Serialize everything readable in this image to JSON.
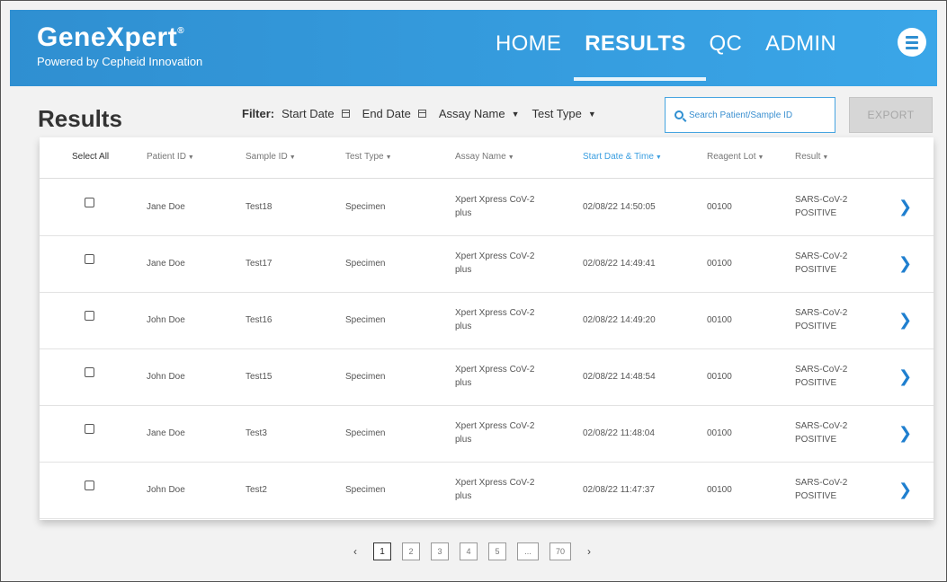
{
  "brand": {
    "name": "GeneXpert",
    "reg": "®",
    "tagline": "Powered by Cepheid Innovation"
  },
  "nav": {
    "items": [
      "HOME",
      "RESULTS",
      "QC",
      "ADMIN"
    ],
    "active": "RESULTS"
  },
  "page": {
    "title": "Results"
  },
  "filter": {
    "label": "Filter:",
    "start_date": "Start Date",
    "end_date": "End Date",
    "assay_name": "Assay Name",
    "test_type": "Test Type"
  },
  "search": {
    "placeholder": "Search Patient/Sample ID"
  },
  "export_label": "EXPORT",
  "table": {
    "headers": {
      "select_all": "Select All",
      "patient_id": "Patient ID",
      "sample_id": "Sample ID",
      "test_type": "Test Type",
      "assay_name": "Assay Name",
      "start_date_time": "Start Date & Time",
      "reagent_lot": "Reagent Lot",
      "result": "Result"
    },
    "sort_glyph": "▼",
    "rows": [
      {
        "patient": "Jane Doe",
        "sample": "Test18",
        "type": "Specimen",
        "assay1": "Xpert Xpress CoV-2",
        "assay2": "plus",
        "datetime": "02/08/22 14:50:05",
        "lot": "00100",
        "result1": "SARS-CoV-2",
        "result2": "POSITIVE"
      },
      {
        "patient": "Jane Doe",
        "sample": "Test17",
        "type": "Specimen",
        "assay1": "Xpert Xpress CoV-2",
        "assay2": "plus",
        "datetime": "02/08/22 14:49:41",
        "lot": "00100",
        "result1": "SARS-CoV-2",
        "result2": "POSITIVE"
      },
      {
        "patient": "John Doe",
        "sample": "Test16",
        "type": "Specimen",
        "assay1": "Xpert Xpress CoV-2",
        "assay2": "plus",
        "datetime": "02/08/22 14:49:20",
        "lot": "00100",
        "result1": "SARS-CoV-2",
        "result2": "POSITIVE"
      },
      {
        "patient": "John Doe",
        "sample": "Test15",
        "type": "Specimen",
        "assay1": "Xpert Xpress CoV-2",
        "assay2": "plus",
        "datetime": "02/08/22 14:48:54",
        "lot": "00100",
        "result1": "SARS-CoV-2",
        "result2": "POSITIVE"
      },
      {
        "patient": "Jane Doe",
        "sample": "Test3",
        "type": "Specimen",
        "assay1": "Xpert Xpress CoV-2",
        "assay2": "plus",
        "datetime": "02/08/22 11:48:04",
        "lot": "00100",
        "result1": "SARS-CoV-2",
        "result2": "POSITIVE"
      },
      {
        "patient": "John Doe",
        "sample": "Test2",
        "type": "Specimen",
        "assay1": "Xpert Xpress CoV-2",
        "assay2": "plus",
        "datetime": "02/08/22 11:47:37",
        "lot": "00100",
        "result1": "SARS-CoV-2",
        "result2": "POSITIVE"
      }
    ]
  },
  "pagination": {
    "prev": "‹",
    "next": "›",
    "pages": [
      "1",
      "2",
      "3",
      "4",
      "5",
      "...",
      "70"
    ],
    "current": "1"
  },
  "colors": {
    "brand_blue": "#2f8fd1",
    "link_blue": "#1f7fcf"
  }
}
